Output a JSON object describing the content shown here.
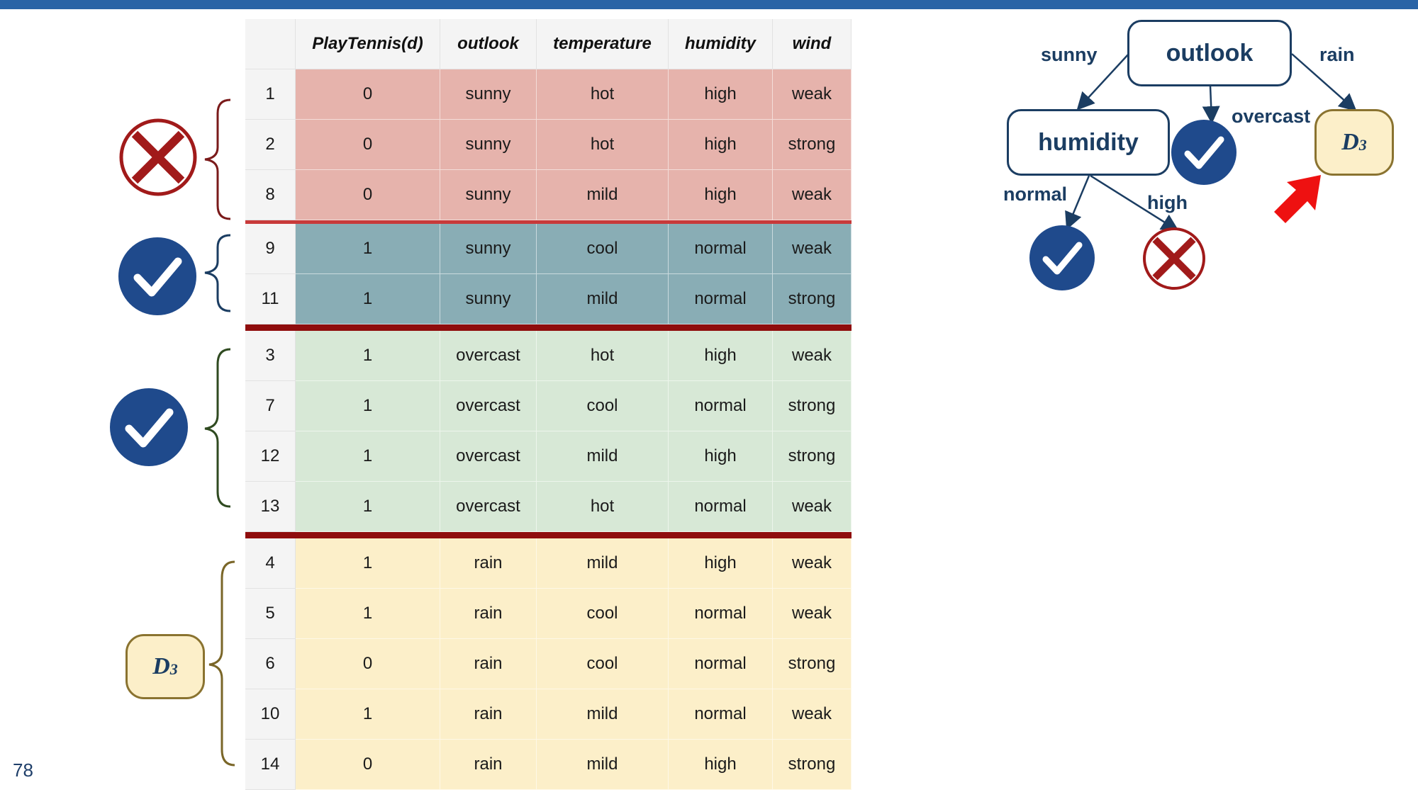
{
  "slide": {
    "page_number": "78"
  },
  "table": {
    "columns": [
      "",
      "PlayTennis(d)",
      "outlook",
      "temperature",
      "humidity",
      "wind"
    ],
    "groups": [
      {
        "name": "sunny-high",
        "rows": [
          [
            "1",
            "0",
            "sunny",
            "hot",
            "high",
            "weak"
          ],
          [
            "2",
            "0",
            "sunny",
            "hot",
            "high",
            "strong"
          ],
          [
            "8",
            "0",
            "sunny",
            "mild",
            "high",
            "weak"
          ]
        ]
      },
      {
        "name": "sunny-normal",
        "rows": [
          [
            "9",
            "1",
            "sunny",
            "cool",
            "normal",
            "weak"
          ],
          [
            "11",
            "1",
            "sunny",
            "mild",
            "normal",
            "strong"
          ]
        ]
      },
      {
        "name": "overcast",
        "rows": [
          [
            "3",
            "1",
            "overcast",
            "hot",
            "high",
            "weak"
          ],
          [
            "7",
            "1",
            "overcast",
            "cool",
            "normal",
            "strong"
          ],
          [
            "12",
            "1",
            "overcast",
            "mild",
            "high",
            "strong"
          ],
          [
            "13",
            "1",
            "overcast",
            "hot",
            "normal",
            "weak"
          ]
        ]
      },
      {
        "name": "rain",
        "rows": [
          [
            "4",
            "1",
            "rain",
            "mild",
            "high",
            "weak"
          ],
          [
            "5",
            "1",
            "rain",
            "cool",
            "normal",
            "weak"
          ],
          [
            "6",
            "0",
            "rain",
            "cool",
            "normal",
            "strong"
          ],
          [
            "10",
            "1",
            "rain",
            "mild",
            "normal",
            "weak"
          ],
          [
            "14",
            "0",
            "rain",
            "mild",
            "high",
            "strong"
          ]
        ]
      }
    ]
  },
  "side_markers": {
    "d3_label": "D",
    "d3_subscript": "3"
  },
  "tree": {
    "root": "outlook",
    "child_left": "humidity",
    "edge_sunny": "sunny",
    "edge_overcast": "overcast",
    "edge_rain": "rain",
    "edge_normal": "normal",
    "edge_high": "high",
    "leaf_label": "D",
    "leaf_subscript": "3"
  },
  "colors": {
    "accent_bar": "#2a64a6",
    "red_group": "#e6b3ac",
    "teal_group": "#89adb5",
    "green_group": "#d7e8d6",
    "yellow_group": "#fcefc9",
    "check": "#1f4a8c",
    "cross": "#a11a1a",
    "arrow": "#ee1111"
  },
  "icons": [
    "check-icon",
    "cross-icon",
    "arrow-icon",
    "brace-icon"
  ]
}
